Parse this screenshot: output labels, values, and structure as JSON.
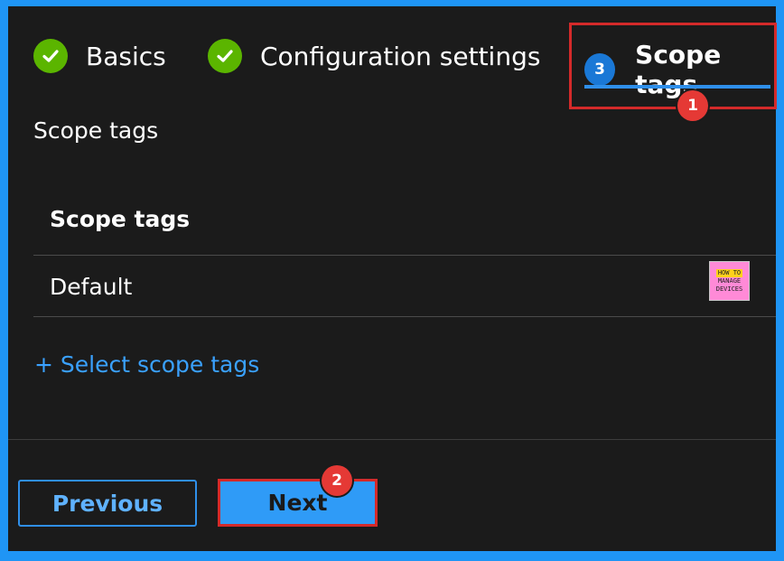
{
  "wizard": {
    "steps": [
      {
        "label": "Basics",
        "state": "complete"
      },
      {
        "label": "Configuration settings",
        "state": "complete"
      },
      {
        "label": "Scope tags",
        "state": "active",
        "number": "3"
      }
    ]
  },
  "callouts": [
    "1",
    "2"
  ],
  "section": {
    "label": "Scope tags",
    "table": {
      "header": "Scope tags",
      "rows": [
        "Default"
      ]
    },
    "add_link": "+ Select scope tags"
  },
  "logo": {
    "line1": "HOW TO",
    "line2": "MANAGE",
    "line3": "DEVICES"
  },
  "footer": {
    "previous_label": "Previous",
    "next_label": "Next"
  },
  "colors": {
    "accent": "#1f95f5",
    "complete": "#5bb500",
    "highlight_box": "#d42a2a",
    "link": "#3aa1ff",
    "background": "#1b1b1b"
  }
}
